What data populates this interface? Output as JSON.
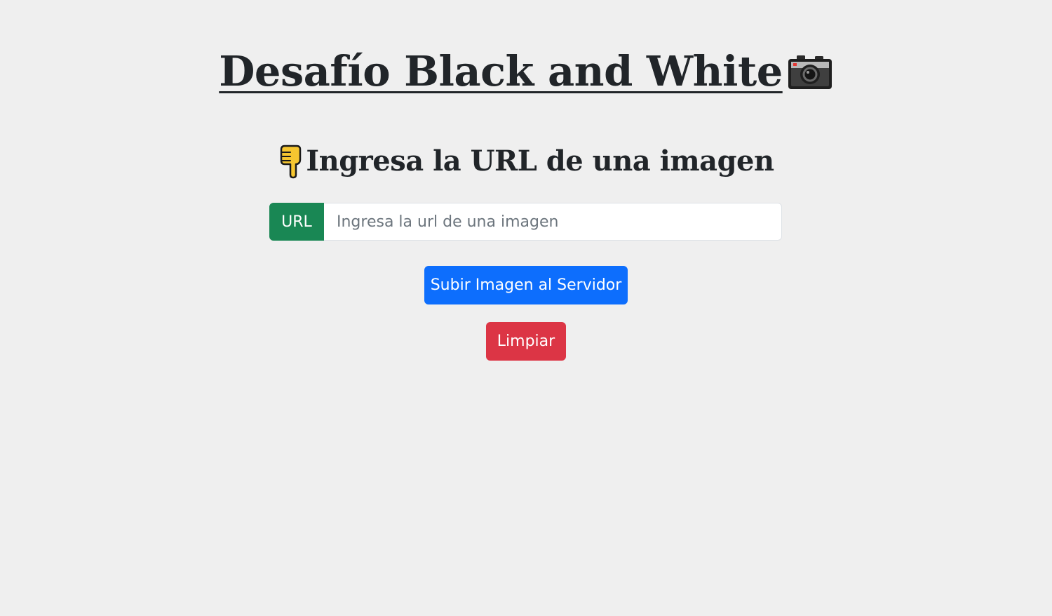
{
  "header": {
    "title": "Desafío Black and White",
    "title_icon": "camera-icon"
  },
  "main": {
    "subtitle": "Ingresa la URL de una imagen",
    "subtitle_icon": "pointing-down-hand-icon",
    "url_field": {
      "label": "URL",
      "placeholder": "Ingresa la url de una imagen",
      "value": ""
    },
    "upload_button_label": "Subir Imagen al Servidor",
    "clear_button_label": "Limpiar"
  },
  "colors": {
    "background": "#efefef",
    "label_green": "#198754",
    "primary_blue": "#0d6efd",
    "danger_red": "#dc3545",
    "text": "#212529"
  }
}
